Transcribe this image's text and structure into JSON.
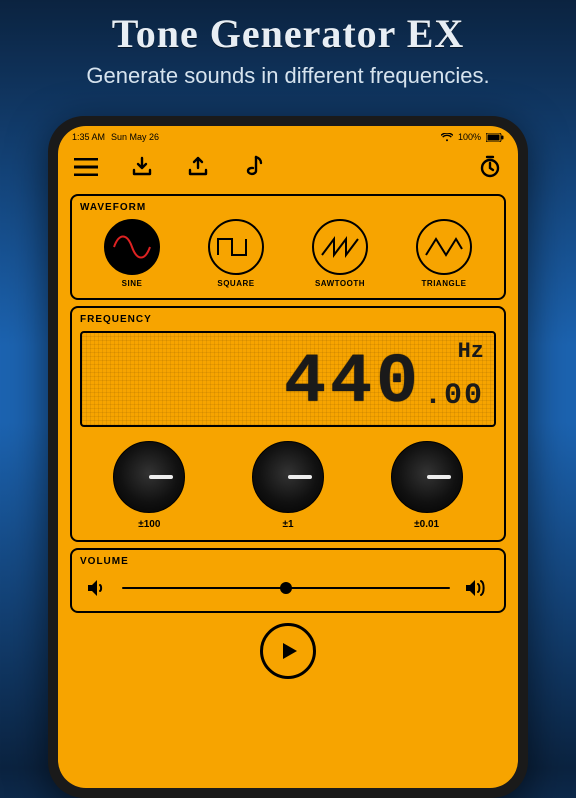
{
  "promo": {
    "title": "Tone Generator EX",
    "subtitle": "Generate sounds in different frequencies."
  },
  "statusbar": {
    "time": "1:35 AM",
    "date": "Sun May 26",
    "battery": "100%"
  },
  "sections": {
    "waveform_label": "WAVEFORM",
    "frequency_label": "FREQUENCY",
    "volume_label": "VOLUME"
  },
  "waveforms": [
    {
      "id": "sine",
      "label": "SINE",
      "selected": true
    },
    {
      "id": "square",
      "label": "SQUARE",
      "selected": false
    },
    {
      "id": "sawtooth",
      "label": "SAWTOOTH",
      "selected": false
    },
    {
      "id": "triangle",
      "label": "TRIANGLE",
      "selected": false
    }
  ],
  "frequency": {
    "unit": "Hz",
    "integer": "440",
    "decimal": ".00",
    "knobs": [
      {
        "label": "±100"
      },
      {
        "label": "±1"
      },
      {
        "label": "±0.01"
      }
    ]
  },
  "volume": {
    "value": 0.5
  },
  "colors": {
    "accent": "#f7a400",
    "ink": "#000000"
  }
}
